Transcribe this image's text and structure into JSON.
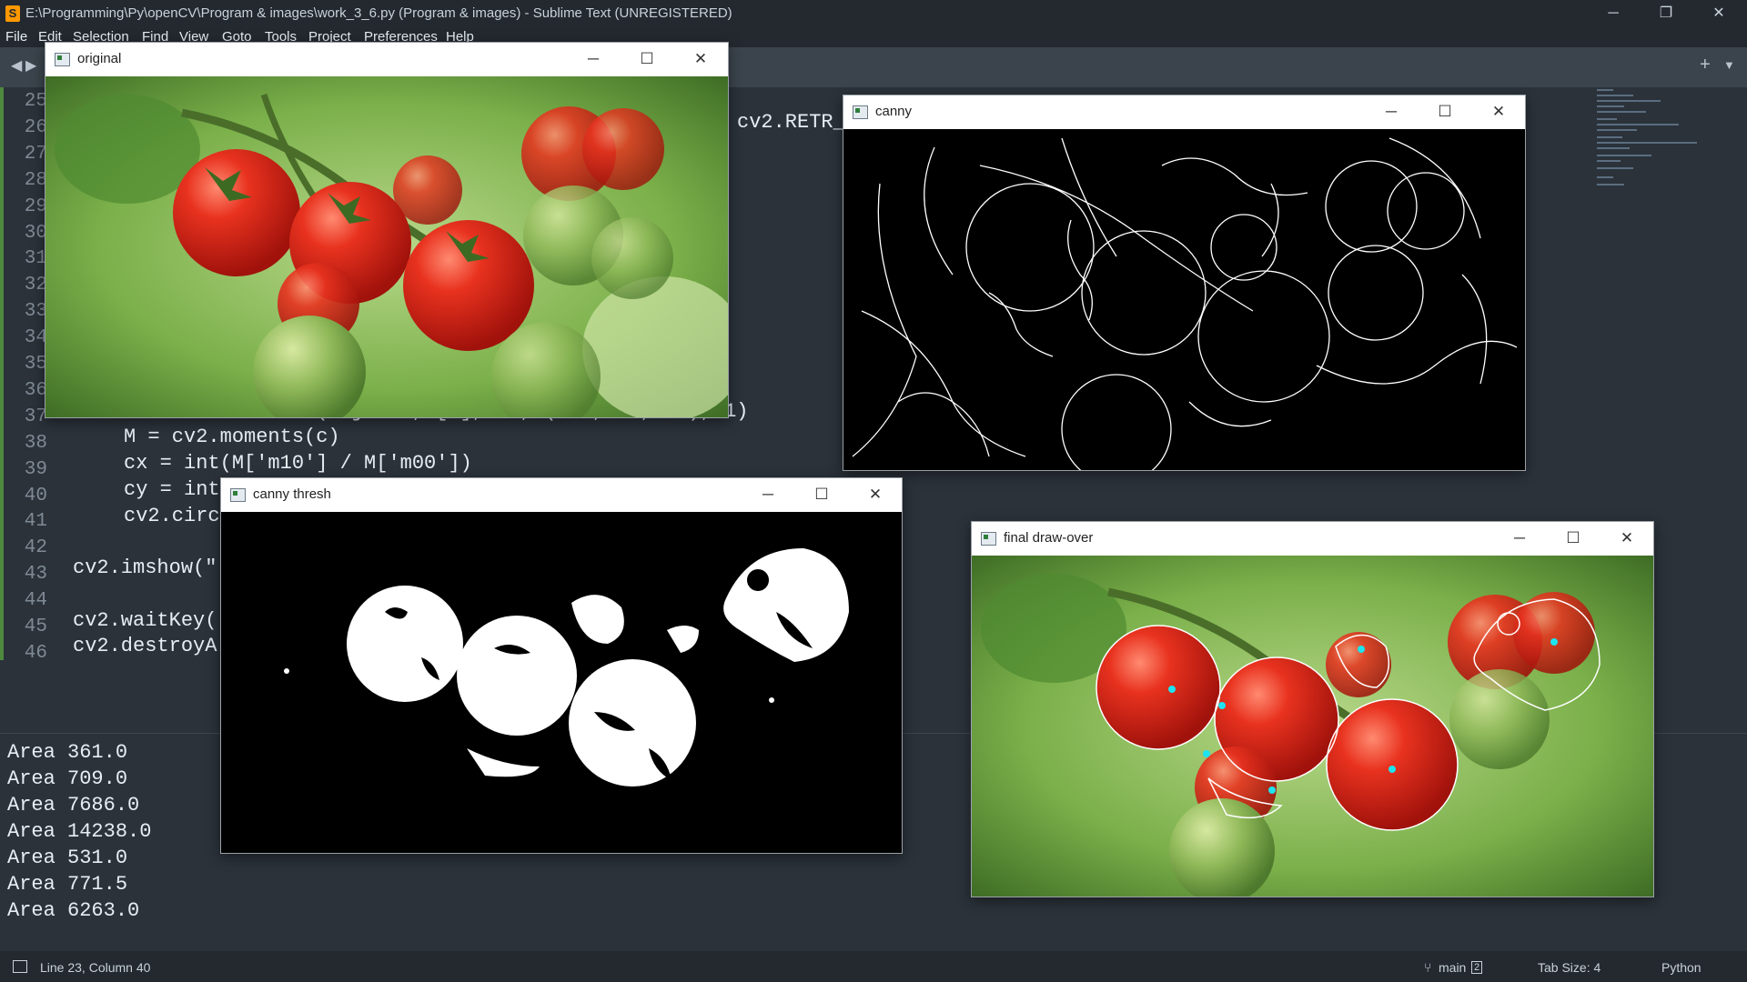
{
  "app": {
    "title": "E:\\Programming\\Py\\openCV\\Program & images\\work_3_6.py (Program & images) - Sublime Text (UNREGISTERED)",
    "logo": "S"
  },
  "window_controls": {
    "minimize": "─",
    "maximize": "❐",
    "close": "✕"
  },
  "menu": [
    "File",
    "Edit",
    "Selection",
    "Find",
    "View",
    "Goto",
    "Tools",
    "Project",
    "Preferences",
    "Help"
  ],
  "tabstrip": {
    "back": "◀",
    "forward": "▶",
    "new_tab": "+",
    "tab_menu": "▼"
  },
  "editor": {
    "line_numbers": [
      "25",
      "26",
      "27",
      "28",
      "29",
      "30",
      "31",
      "32",
      "33",
      "34",
      "35",
      "36",
      "37",
      "38",
      "39",
      "40",
      "41",
      "42",
      "43",
      "44",
      "45",
      "46"
    ],
    "code": {
      "l26_tail": "cv2.RETR_",
      "l37": "cv2.drawContours(objects, [c], -1, (255,255,255), 1)",
      "l38": "M = cv2.moments(c)",
      "l39": "cx = int(M['m10'] / M['m00'])",
      "l40": "cy = int",
      "l41": "cv2.circ",
      "l43": "cv2.imshow(\"",
      "l45": "cv2.waitKey(",
      "l46": "cv2.destroyA"
    }
  },
  "output": [
    "Area 361.0",
    "Area 709.0",
    "Area 7686.0",
    "Area 14238.0",
    "Area 531.0",
    "Area 771.5",
    "Area 6263.0"
  ],
  "status": {
    "position": "Line 23, Column 40",
    "branch": "main",
    "branch_count": "2",
    "tab_size": "Tab Size: 4",
    "syntax": "Python"
  },
  "cv_windows": {
    "original": {
      "title": "original"
    },
    "canny": {
      "title": "canny"
    },
    "thresh": {
      "title": "canny thresh"
    },
    "final": {
      "title": "final draw-over"
    }
  },
  "cv_controls": {
    "minimize": "─",
    "maximize": "☐",
    "close": "✕"
  },
  "colors": {
    "editor_bg": "#2b323a",
    "tomato_red": "#e0251c",
    "leaf_green": "#6aa23a",
    "marker_cyan": "#1ee3f0",
    "outline_white": "#ffffff"
  }
}
